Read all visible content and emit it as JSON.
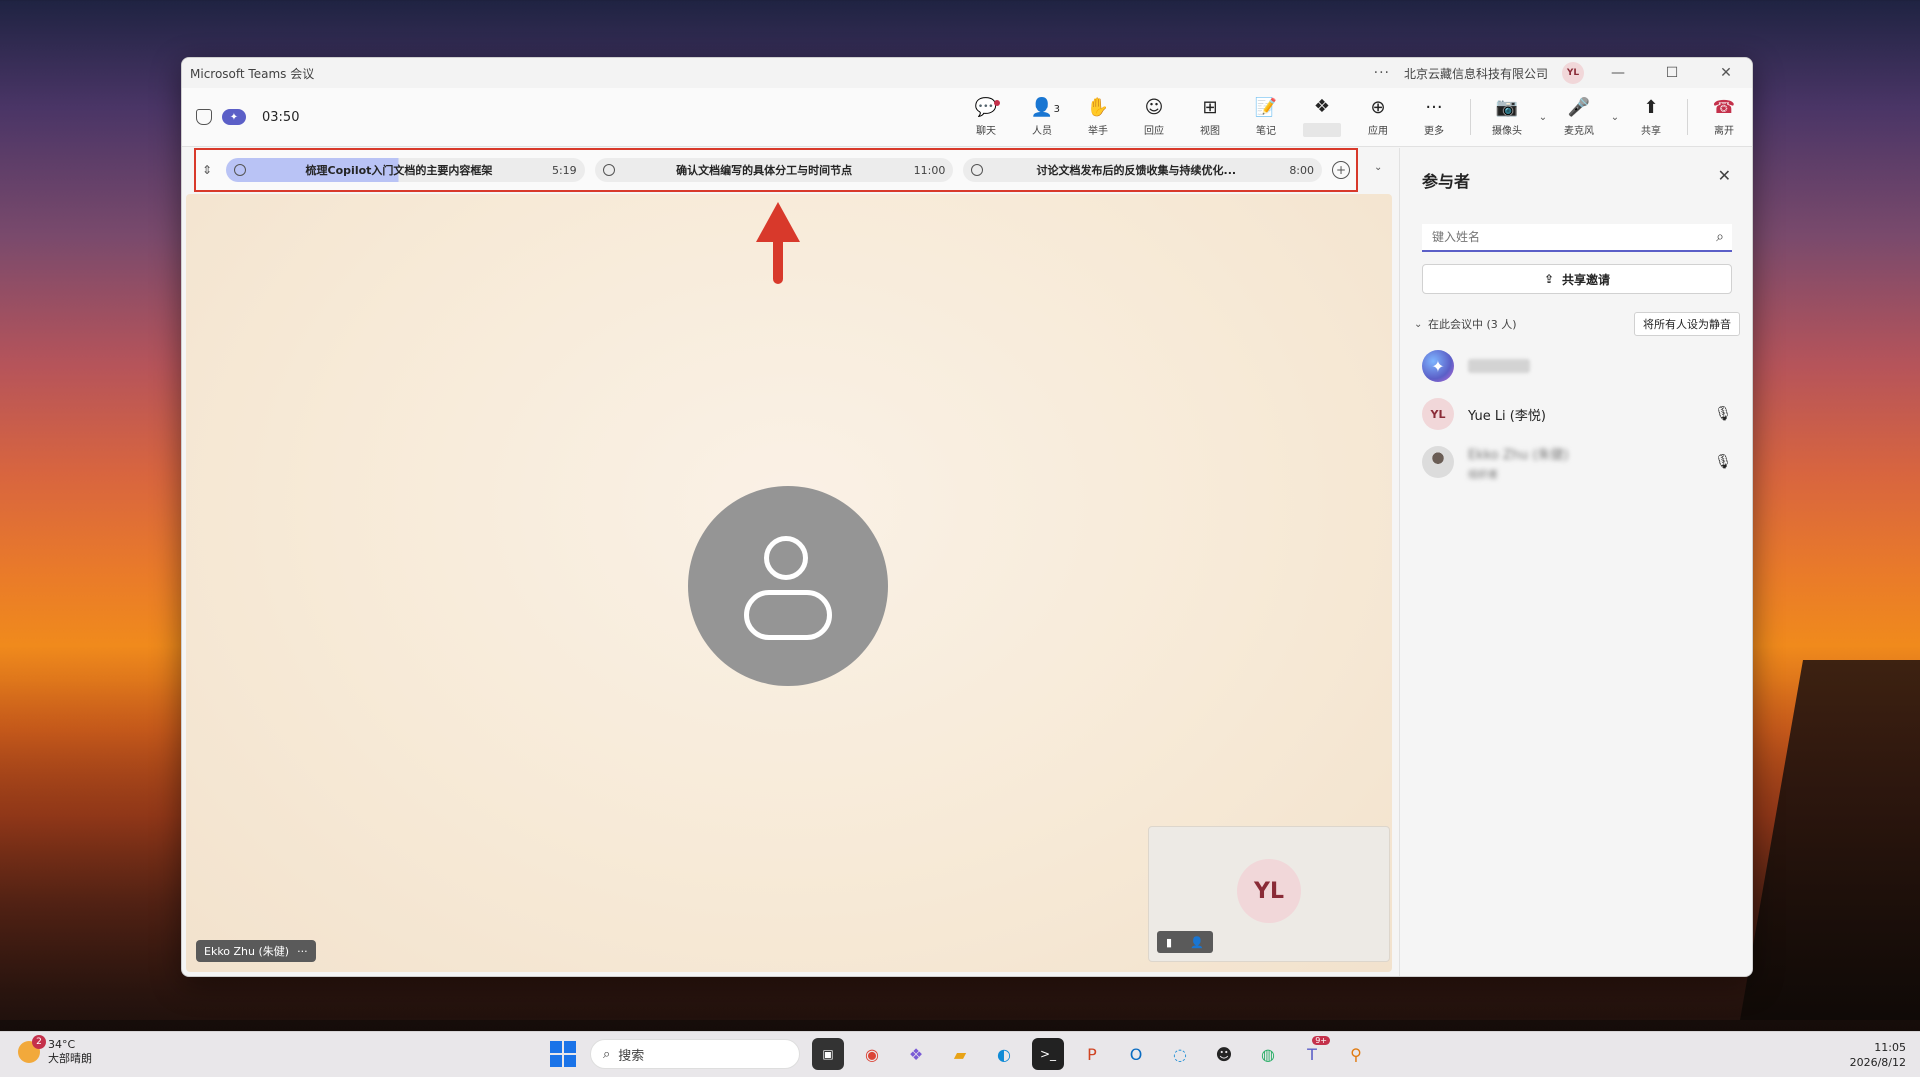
{
  "window": {
    "title": "Microsoft Teams 会议",
    "org": "北京云藏信息科技有限公司",
    "user_initials": "YL"
  },
  "toolbar": {
    "timer": "03:50",
    "tools": [
      {
        "label": "聊天",
        "icon": "chat-icon"
      },
      {
        "label": "人员",
        "icon": "people-icon",
        "count": "3"
      },
      {
        "label": "举手",
        "icon": "hand-icon"
      },
      {
        "label": "回应",
        "icon": "emoji-icon"
      },
      {
        "label": "视图",
        "icon": "grid-icon"
      },
      {
        "label": "笔记",
        "icon": "notes-icon"
      },
      {
        "label": "",
        "icon": "copilot-icon"
      },
      {
        "label": "应用",
        "icon": "apps-icon"
      },
      {
        "label": "更多",
        "icon": "more-icon"
      }
    ],
    "camera_label": "摄像头",
    "mic_label": "麦克风",
    "share_label": "共享",
    "leave_label": "离开"
  },
  "agenda": [
    {
      "title": "梳理Copilot入门文档的主要内容框架",
      "duration": "5:19",
      "active": true
    },
    {
      "title": "确认文档编写的具体分工与时间节点",
      "duration": "11:00",
      "active": false
    },
    {
      "title": "讨论文档发布后的反馈收集与持续优化...",
      "duration": "8:00",
      "active": false
    }
  ],
  "stage": {
    "speaker_name": "Ekko Zhu (朱健)",
    "speaker_more": "···",
    "self_initials": "YL"
  },
  "panel": {
    "title": "参与者",
    "search_placeholder": "键入姓名",
    "share_invite": "共享邀请",
    "in_meeting": "在此会议中 (3 人)",
    "mute_all": "将所有人设为静音",
    "participants": [
      {
        "name": "",
        "avatar": "copilot",
        "blurred": true
      },
      {
        "name": "Yue Li (李悦)",
        "initials": "YL",
        "avatar": "initials"
      },
      {
        "name": "Ekko Zhu (朱健)",
        "subtitle": "组织者",
        "avatar": "photo",
        "blurred": true
      }
    ]
  },
  "taskbar": {
    "weather_temp": "34°C",
    "weather_desc": "大部晴朗",
    "weather_badge": "2",
    "search_label": "搜索",
    "teams_badge": "9+",
    "time": "11:05",
    "date": "2026/8/12"
  }
}
